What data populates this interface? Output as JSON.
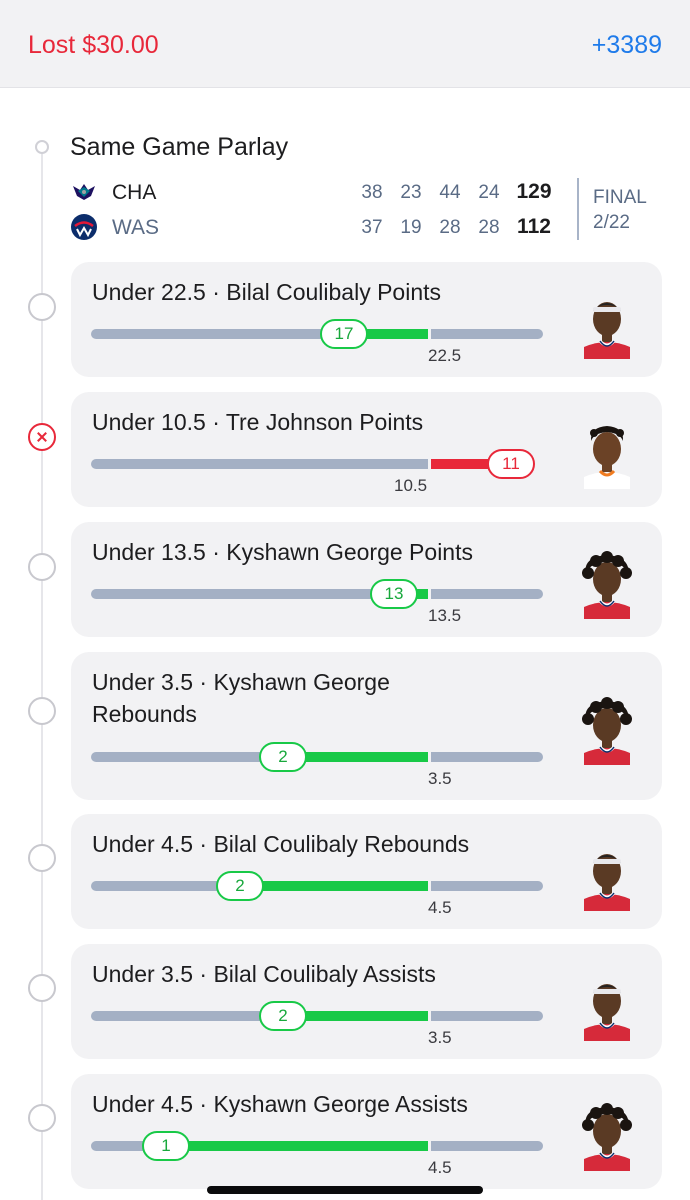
{
  "header": {
    "result": "Lost $30.00",
    "odds": "+3389"
  },
  "parlay": {
    "title": "Same Game Parlay",
    "teams": [
      {
        "abbr": "CHA",
        "quarters": [
          "38",
          "23",
          "44",
          "24"
        ],
        "total": "129",
        "logo": "hornets-logo"
      },
      {
        "abbr": "WAS",
        "quarters": [
          "37",
          "19",
          "28",
          "28"
        ],
        "total": "112",
        "logo": "wizards-logo"
      }
    ],
    "status": "FINAL",
    "date": "2/22"
  },
  "legs": [
    {
      "title": "Under 22.5 · Bilal Coulibaly Points",
      "actual": "17",
      "line": "22.5",
      "result": "win",
      "actual_pct": 0.56,
      "line_pct": 0.745
    },
    {
      "title": "Under 10.5 · Tre Johnson Points",
      "actual": "11",
      "line": "10.5",
      "result": "loss",
      "actual_pct": 0.93,
      "line_pct": 0.745
    },
    {
      "title": "Under 13.5 · Kyshawn George Points",
      "actual": "13",
      "line": "13.5",
      "result": "win",
      "actual_pct": 0.67,
      "line_pct": 0.745
    },
    {
      "title": "Under 3.5 · Kyshawn George Rebounds",
      "actual": "2",
      "line": "3.5",
      "result": "win",
      "actual_pct": 0.425,
      "line_pct": 0.745
    },
    {
      "title": "Under 4.5 · Bilal Coulibaly Rebounds",
      "actual": "2",
      "line": "4.5",
      "result": "win",
      "actual_pct": 0.33,
      "line_pct": 0.745
    },
    {
      "title": "Under 3.5 · Bilal Coulibaly Assists",
      "actual": "2",
      "line": "3.5",
      "result": "win",
      "actual_pct": 0.425,
      "line_pct": 0.745
    },
    {
      "title": "Under 4.5 · Kyshawn George Assists",
      "actual": "1",
      "line": "4.5",
      "result": "win",
      "actual_pct": 0.165,
      "line_pct": 0.745
    }
  ],
  "colors": {
    "loss": "#e8283a",
    "win": "#18c947",
    "accent": "#1f7bea",
    "bar": "#a4b0c4"
  }
}
